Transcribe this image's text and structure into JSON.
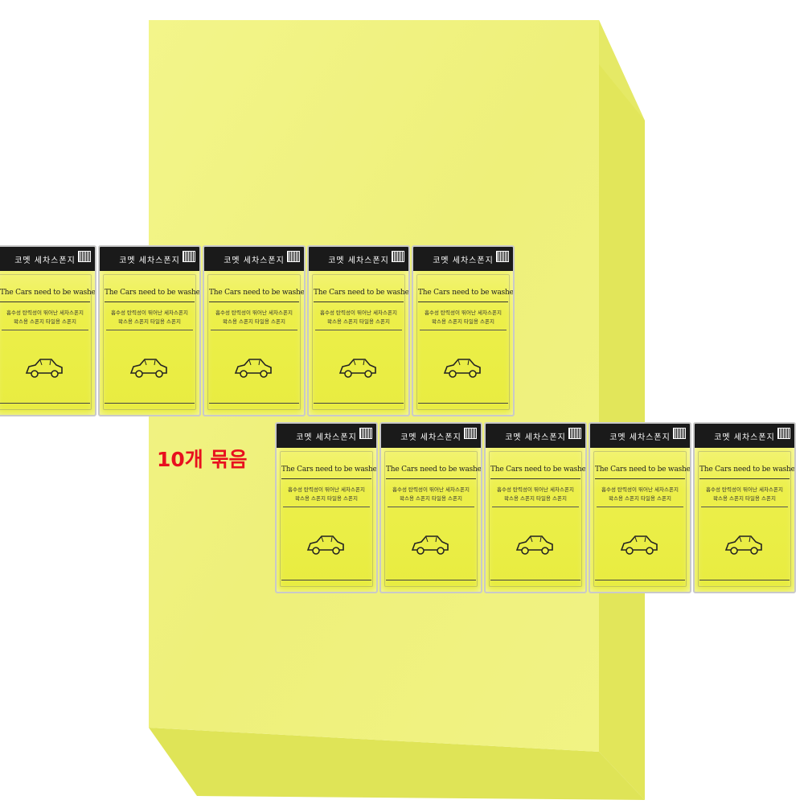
{
  "product": {
    "bundle_label": "10개 묶음",
    "pack_brand": "코멧 세차스폰지",
    "pack_slogan": "The Cars need to be washed",
    "pack_desc_line1": "흡수성 탄력성이 뛰어난 세차스폰지",
    "pack_desc_line2": "왁스용 스폰지 타일용 스폰지",
    "pack_count": 10,
    "icons": [
      "barcode-icon",
      "car-icon"
    ]
  },
  "colors": {
    "sponge": "#f0f27e",
    "pack_yellow": "#ecef4a",
    "pack_header": "#1a1a1a",
    "bundle_label": "#e8101e"
  }
}
